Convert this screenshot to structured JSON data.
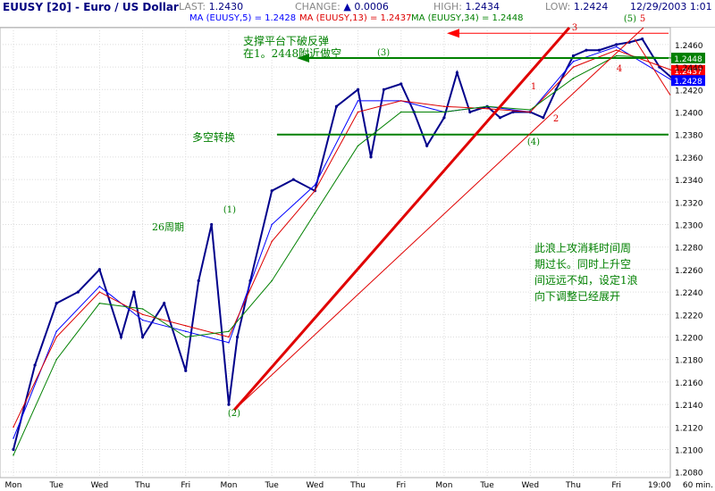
{
  "header": {
    "symbol": "EUUSY [20] - Euro / US Dollar",
    "last_label": "LAST:",
    "last_value": "1.2430",
    "change_label": "CHANGE:",
    "change_arrow": "▲",
    "change_value": "0.0006",
    "high_label": "HIGH:",
    "high_value": "1.2434",
    "low_label": "LOW:",
    "low_value": "1.2424",
    "date": "12/29/2003 1:01",
    "ma5": "MA (EUUSY,5) = 1.2428",
    "ma13": "MA (EUUSY,13) = 1.2437",
    "ma34": "MA (EUUSY,34) = 1.2448"
  },
  "chart_data": {
    "type": "line",
    "title": "EUUSY [20] - Euro / US Dollar",
    "interval": "60 min.",
    "x_categories": [
      "Mon",
      "Tue",
      "Wed",
      "Thu",
      "Fri",
      "Mon",
      "Tue",
      "Wed",
      "Thu",
      "Fri",
      "Mon",
      "Tue",
      "Wed",
      "Thu",
      "Fri",
      "19:00"
    ],
    "ylim": [
      1.2075,
      1.2475
    ],
    "y_ticks": [
      1.208,
      1.21,
      1.212,
      1.214,
      1.216,
      1.218,
      1.22,
      1.222,
      1.224,
      1.226,
      1.228,
      1.23,
      1.232,
      1.234,
      1.236,
      1.238,
      1.24,
      1.242,
      1.244,
      1.246
    ],
    "y_tick_labels": [
      "1.2080",
      "1.2100",
      "1.2120",
      "1.2140",
      "1.2160",
      "1.2180",
      "1.2200",
      "1.2220",
      "1.2240",
      "1.2260",
      "1.2280",
      "1.2300",
      "1.2320",
      "1.2340",
      "1.2360",
      "1.2380",
      "1.2400",
      "1.2420",
      "1.2440",
      "1.2460"
    ],
    "grid": true,
    "series": [
      {
        "name": "EUUSY",
        "color": "#00008b",
        "x": [
          0,
          0.5,
          1,
          1.5,
          2,
          2.5,
          2.8,
          3,
          3.5,
          4,
          4.3,
          4.6,
          5,
          5.2,
          5.5,
          6,
          6.5,
          7,
          7.5,
          8,
          8.3,
          8.6,
          9,
          9.3,
          9.6,
          10,
          10.3,
          10.6,
          11,
          11.3,
          11.6,
          12,
          12.3,
          12.6,
          13,
          13.3,
          13.6,
          14,
          14.3,
          14.6,
          15,
          15.3
        ],
        "values": [
          1.21,
          1.2175,
          1.223,
          1.224,
          1.226,
          1.22,
          1.224,
          1.22,
          1.223,
          1.217,
          1.225,
          1.23,
          1.214,
          1.22,
          1.225,
          1.233,
          1.234,
          1.233,
          1.2405,
          1.242,
          1.236,
          1.242,
          1.2425,
          1.24,
          1.237,
          1.2395,
          1.2435,
          1.24,
          1.2405,
          1.2395,
          1.24,
          1.24,
          1.2395,
          1.242,
          1.245,
          1.2455,
          1.2455,
          1.246,
          1.2462,
          1.2465,
          1.244,
          1.243
        ]
      },
      {
        "name": "MA (EUUSY,5)",
        "color": "#0000ff",
        "x": [
          0,
          1,
          2,
          3,
          4,
          5,
          6,
          7,
          8,
          9,
          10,
          11,
          12,
          13,
          14,
          15.3
        ],
        "values": [
          1.211,
          1.2205,
          1.2245,
          1.2215,
          1.2205,
          1.2195,
          1.23,
          1.2335,
          1.241,
          1.241,
          1.24,
          1.2405,
          1.24,
          1.2445,
          1.2458,
          1.2428
        ]
      },
      {
        "name": "MA (EUUSY,13)",
        "color": "#dd0000",
        "x": [
          0,
          1,
          2,
          3,
          4,
          5,
          6,
          7,
          8,
          9,
          10,
          11,
          12,
          13,
          14,
          15.3
        ],
        "values": [
          1.212,
          1.22,
          1.224,
          1.222,
          1.221,
          1.22,
          1.2285,
          1.233,
          1.24,
          1.241,
          1.2405,
          1.2403,
          1.24,
          1.244,
          1.2455,
          1.2437
        ]
      },
      {
        "name": "MA (EUUSY,34)",
        "color": "#008000",
        "x": [
          0,
          1,
          2,
          3,
          4,
          5,
          6,
          7,
          8,
          9,
          10,
          11,
          12,
          13,
          14,
          15.3
        ],
        "values": [
          1.2095,
          1.218,
          1.223,
          1.2225,
          1.22,
          1.2205,
          1.225,
          1.231,
          1.237,
          1.24,
          1.24,
          1.2405,
          1.2402,
          1.243,
          1.245,
          1.2448
        ]
      }
    ],
    "levels": [
      {
        "label": "1.2448",
        "value": 1.2448,
        "color": "#008000"
      },
      {
        "label": "1.2437",
        "value": 1.2437,
        "color": "#ff0000"
      },
      {
        "label": "1.2428",
        "value": 1.2428,
        "color": "#0000ff"
      }
    ],
    "annotations": {
      "text1": "支撑平台下破反弹",
      "text2": "在1。2448附近做空",
      "label_3a": "(3)",
      "duo_kong": "多空转换",
      "cycle": "26周期",
      "label_1": "(1)",
      "label_2": "(2)",
      "label_4": "(4)",
      "label_5": "(5)",
      "num_1": "1",
      "num_2": "2",
      "num_3": "3",
      "num_4": "4",
      "num_5": "5",
      "comment1": "此浪上攻消耗时间周",
      "comment2": "期过长。同时上升空",
      "comment3": "间远远不如，设定1浪",
      "comment4": "向下调整已经展开"
    }
  }
}
